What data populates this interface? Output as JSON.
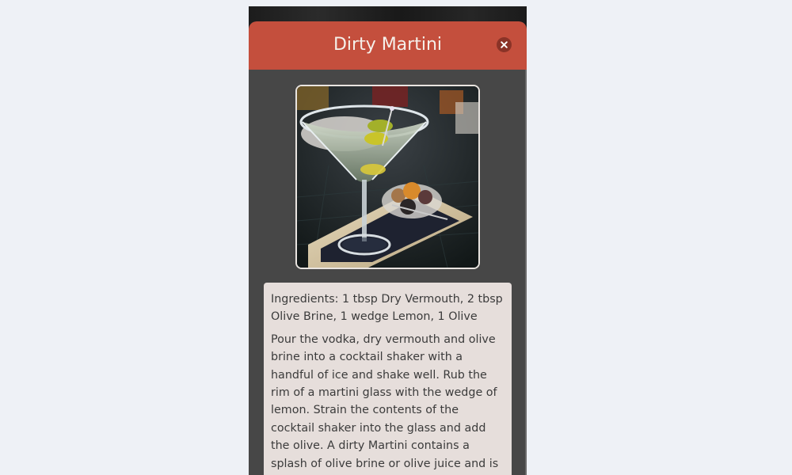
{
  "modal": {
    "title": "Dirty Martini",
    "close_icon": "close-icon",
    "header_color": "#c44f3d",
    "body_color": "#474747"
  },
  "image": {
    "description_icon": "martini-photo",
    "alt": "Dirty Martini"
  },
  "recipe": {
    "ingredients": "Ingredients: 1 tbsp Dry Vermouth, 2 tbsp Olive Brine, 1 wedge Lemon, 1 Olive",
    "instructions": "Pour the vodka, dry vermouth and olive brine into a cocktail shaker with a handful of ice and shake well. Rub the rim of a martini glass with the wedge of lemon. Strain the contents of the cocktail shaker into the glass and add the olive. A dirty Martini contains a splash of olive brine or olive juice and is typically garnished with an olive."
  }
}
